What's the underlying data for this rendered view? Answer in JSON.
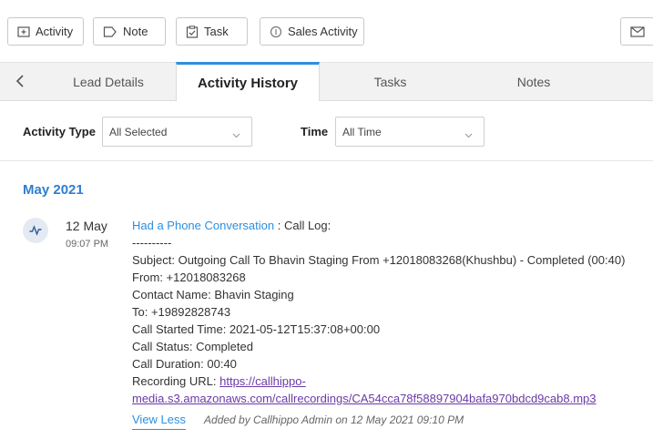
{
  "toolbar": {
    "activity_label": "Activity",
    "note_label": "Note",
    "task_label": "Task",
    "sales_activity_label": "Sales Activity"
  },
  "tabs": [
    {
      "label": "Lead Details"
    },
    {
      "label": "Activity History",
      "active": true
    },
    {
      "label": "Tasks"
    },
    {
      "label": "Notes"
    }
  ],
  "filters": {
    "activity_type_label": "Activity Type",
    "activity_type_value": "All Selected",
    "time_label": "Time",
    "time_value": "All Time"
  },
  "timeline": {
    "month": "May 2021",
    "entry": {
      "day": "12 May",
      "time": "09:07 PM",
      "title_link": "Had a Phone Conversation",
      "title_suffix": " : Call Log:",
      "separator": "----------",
      "subject": "Subject: Outgoing Call To Bhavin Staging From +12018083268(Khushbu) - Completed (00:40)",
      "from": "From: +12018083268",
      "contact_name": "Contact Name: Bhavin Staging",
      "to": "To: +19892828743",
      "call_started": "Call Started Time: 2021-05-12T15:37:08+00:00",
      "call_status": "Call Status: Completed",
      "call_duration": "Call Duration: 00:40",
      "recording_label": "Recording URL: ",
      "recording_url_part1": "https://callhippo-",
      "recording_url_part2": "media.s3.amazonaws.com/callrecordings/CA54cca78f58897904bafa970bdcd9cab8.mp3",
      "view_less": "View Less",
      "added_by": "Added by Callhippo Admin on 12 May 2021 09:10 PM"
    }
  },
  "colors": {
    "accent": "#2d8fe0",
    "link_visited": "#6a3aa8",
    "tab_bar_bg": "#f2f2f2"
  },
  "icons": [
    "activity-add-icon",
    "note-icon",
    "task-check-icon",
    "sales-activity-icon",
    "mail-icon",
    "chevron-left-icon",
    "chevron-down-icon",
    "phone-activity-icon"
  ]
}
